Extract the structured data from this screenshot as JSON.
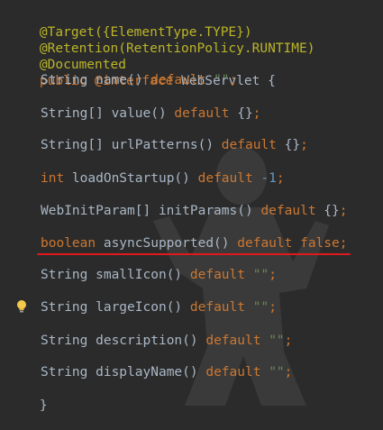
{
  "code": {
    "annotation_target": "@Target({ElementType.TYPE})",
    "annotation_retention": "@Retention(RetentionPolicy.RUNTIME)",
    "annotation_documented": "@Documented",
    "decl": {
      "kw_public": "public",
      "kw_interface": "@interface",
      "name": "WebServlet",
      "brace": " {"
    },
    "members": [
      {
        "type": "String",
        "type_is_kw": false,
        "sig": " name() ",
        "default": "default",
        "value": "\"\"",
        "value_kind": "str",
        "end": ";"
      },
      {
        "type": "String[]",
        "type_is_kw": false,
        "sig": " value() ",
        "default": "default",
        "value": "{}",
        "value_kind": "plain",
        "end": ";"
      },
      {
        "type": "String[]",
        "type_is_kw": false,
        "sig": " urlPatterns() ",
        "default": "default",
        "value": "{}",
        "value_kind": "plain",
        "end": ";"
      },
      {
        "type": "int",
        "type_is_kw": true,
        "sig": " loadOnStartup() ",
        "default": "default",
        "value": "-1",
        "value_kind": "num",
        "end": ";"
      },
      {
        "type": "WebInitParam[]",
        "type_is_kw": false,
        "sig": " initParams() ",
        "default": "default",
        "value": "{}",
        "value_kind": "plain",
        "end": ";"
      },
      {
        "type": "boolean",
        "type_is_kw": true,
        "sig": " asyncSupported() ",
        "default": "default",
        "value": "false",
        "value_kind": "kw",
        "end": ";"
      },
      {
        "type": "String",
        "type_is_kw": false,
        "sig": " smallIcon() ",
        "default": "default",
        "value": "\"\"",
        "value_kind": "str",
        "end": ";"
      },
      {
        "type": "String",
        "type_is_kw": false,
        "sig": " largeIcon() ",
        "default": "default",
        "value": "\"\"",
        "value_kind": "str",
        "end": ";"
      },
      {
        "type": "String",
        "type_is_kw": false,
        "sig": " description() ",
        "default": "default",
        "value": "\"\"",
        "value_kind": "str",
        "end": ";"
      },
      {
        "type": "String",
        "type_is_kw": false,
        "sig": " displayName() ",
        "default": "default",
        "value": "\"\"",
        "value_kind": "str",
        "end": ";"
      }
    ],
    "closing_brace": "}"
  },
  "icons": {
    "gutter": "lightbulb-icon",
    "watermark": "figure-silhouette"
  },
  "colors": {
    "background": "#2b2b2b",
    "annotation": "#bbb529",
    "keyword": "#cc7832",
    "plain": "#a9b7c6",
    "string": "#6a8759",
    "number": "#6897bb",
    "highlight_underline": "#e0191c"
  }
}
